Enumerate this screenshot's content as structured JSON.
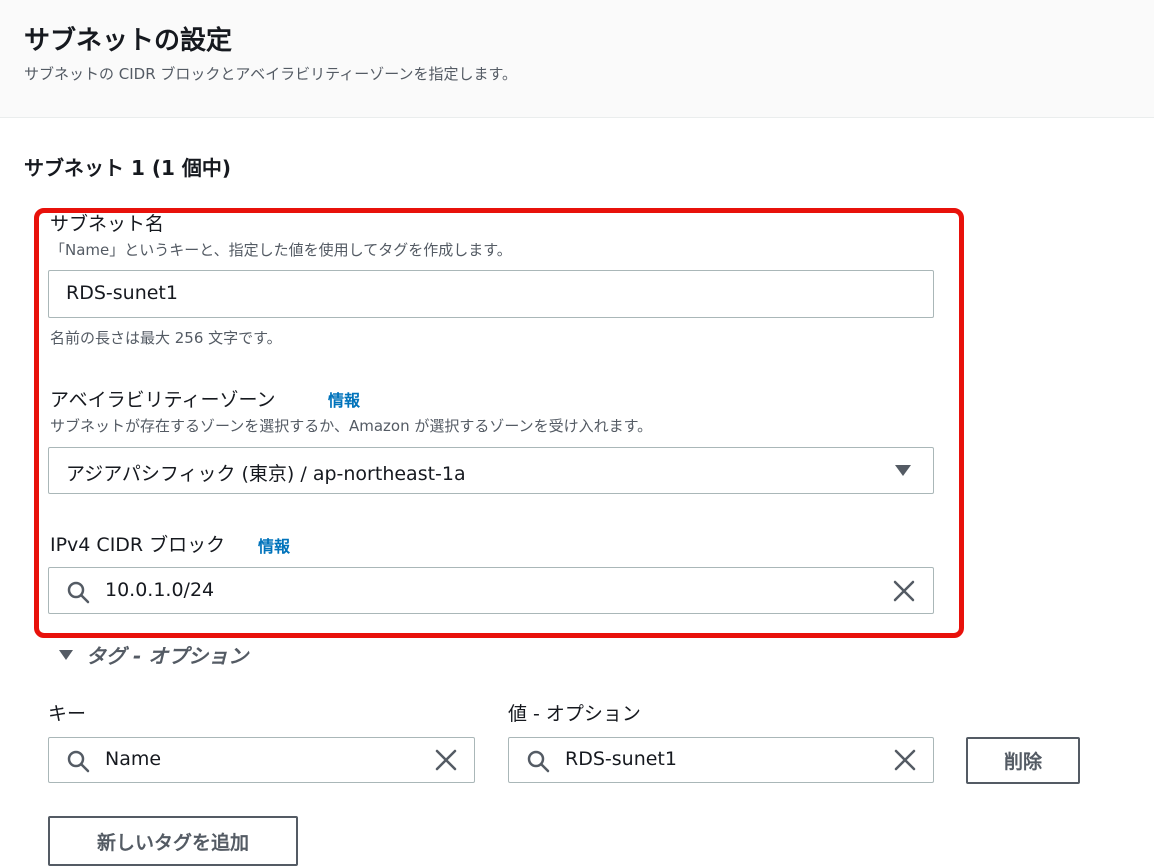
{
  "header": {
    "title": "サブネットの設定",
    "subtitle": "サブネットの CIDR ブロックとアベイラビリティーゾーンを指定します。"
  },
  "subnet": {
    "heading": "サブネット 1 (1 個中)",
    "name": {
      "label": "サブネット名",
      "description": "「Name」というキーと、指定した値を使用してタグを作成します。",
      "value": "RDS-sunet1",
      "hint": "名前の長さは最大 256 文字です。"
    },
    "az": {
      "label": "アベイラビリティーゾーン",
      "info": "情報",
      "description": "サブネットが存在するゾーンを選択するか、Amazon が選択するゾーンを受け入れます。",
      "value": "アジアパシフィック (東京) / ap-northeast-1a"
    },
    "cidr": {
      "label": "IPv4 CIDR ブロック",
      "info": "情報",
      "value": "10.0.1.0/24"
    }
  },
  "tags": {
    "toggle_label": "タグ - オプション",
    "key_label": "キー",
    "value_label": "値 - オプション",
    "key_value": "Name",
    "value_value": "RDS-sunet1",
    "remove_button": "削除",
    "add_button": "新しいタグを追加"
  },
  "colors": {
    "highlight": "#e8110b",
    "link": "#0073bb"
  }
}
